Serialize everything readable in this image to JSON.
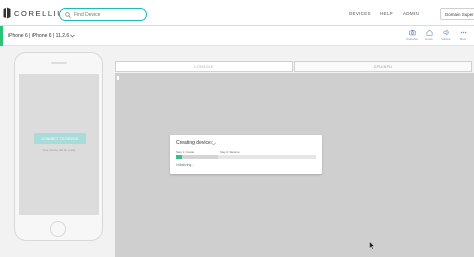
{
  "header": {
    "brand": "CORELLIUM",
    "search": {
      "placeholder": "Find Device",
      "value": ""
    },
    "nav": [
      {
        "label": "DEVICES"
      },
      {
        "label": "HELP"
      },
      {
        "label": "ADMIN"
      }
    ],
    "user": "Domain Super"
  },
  "device_bar": {
    "device_label": "iPhone 6  |  iPhone 6  |  11.2.6",
    "tools": [
      {
        "label": "Snapshot",
        "icon": "camera-icon"
      },
      {
        "label": "Home",
        "icon": "home-icon"
      },
      {
        "label": "Volume",
        "icon": "volume-icon"
      },
      {
        "label": "More",
        "icon": "more-icon"
      }
    ]
  },
  "phone": {
    "button_label": "CONNECT TO DEVICE",
    "sub_text": "Your device will be ready"
  },
  "tabs": [
    {
      "label": "CONSOLE",
      "active": true
    },
    {
      "label": "CPU/NPU",
      "active": false
    }
  ],
  "dialog": {
    "title": "Creating device",
    "step1_label": "Step 1: Create",
    "step2_label": "Step 2: Restore",
    "progress_fraction": 0.04,
    "status": "Initializing..."
  },
  "colors": {
    "accent": "#1bbcb9",
    "success": "#38c087",
    "device_stripe": "#29c37a"
  }
}
